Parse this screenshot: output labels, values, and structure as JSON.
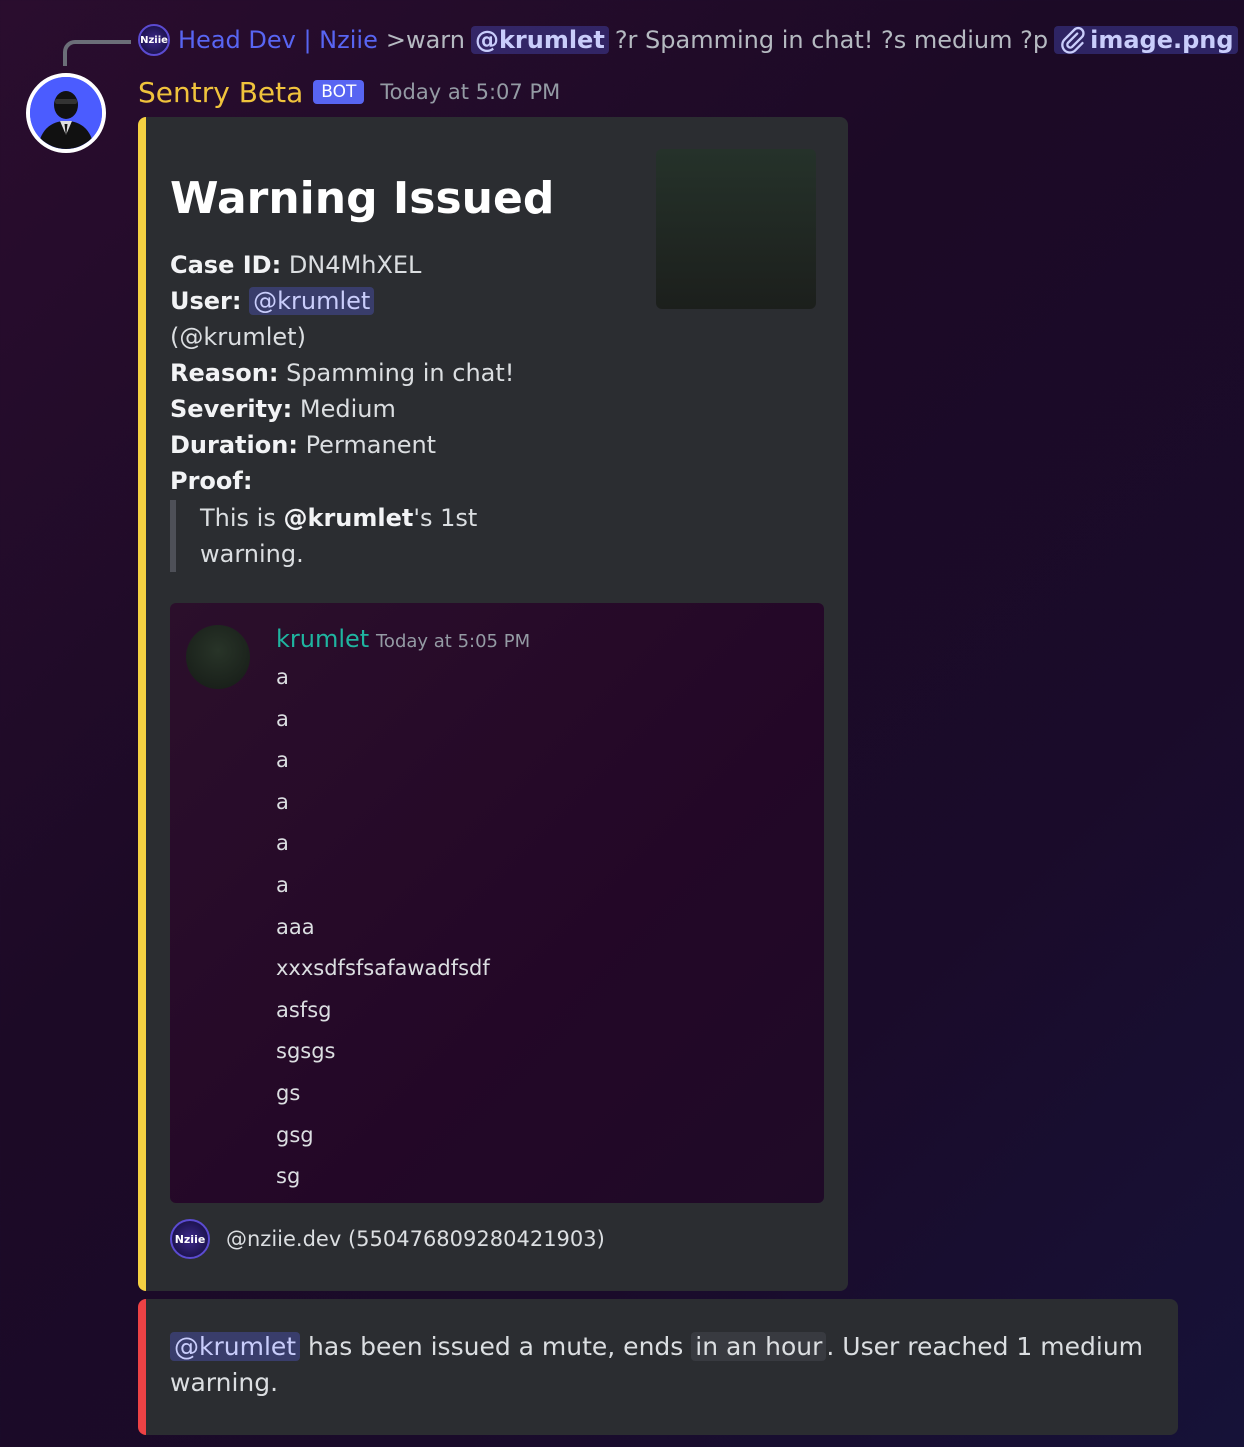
{
  "reply": {
    "avatar_text": "Nziie",
    "author": "Head Dev | Nziie",
    "command_prefix": ">warn",
    "mention": "@krumlet",
    "command_rest": "?r Spamming in chat! ?s medium ?p",
    "attachment": "image.png"
  },
  "message": {
    "bot_name": "Sentry Beta",
    "bot_tag": "BOT",
    "timestamp": "Today at 5:07 PM"
  },
  "embed": {
    "accent_color": "#f5d142",
    "title": "Warning Issued",
    "fields": {
      "case_label": "Case ID:",
      "case_value": "DN4MhXEL",
      "user_label": "User:",
      "user_mention": "@krumlet",
      "user_handle": "(@krumlet)",
      "reason_label": "Reason:",
      "reason_value": "Spamming in chat!",
      "severity_label": "Severity:",
      "severity_value": "Medium",
      "duration_label": "Duration:",
      "duration_value": "Permanent",
      "proof_label": "Proof:"
    },
    "quote": {
      "prefix": "This is",
      "mention": "@krumlet",
      "suffix": "'s 1st warning."
    },
    "proof_message": {
      "author": "krumlet",
      "timestamp": "Today at 5:05 PM",
      "lines": [
        "a",
        "a",
        "a",
        "a",
        "a",
        "a",
        "aaa",
        "xxxsdfsfsafawadfsdf",
        "asfsg",
        "sgsgs",
        "gs",
        "gsg",
        "sg"
      ]
    },
    "footer": {
      "icon_text": "Nziie",
      "text": "@nziie.dev (550476809280421903)"
    }
  },
  "mute_embed": {
    "accent_color": "#ed4245",
    "mention": "@krumlet",
    "text_1": "has been issued a mute, ends",
    "time_badge": "in an hour",
    "text_2": ". User reached 1 medium warning."
  }
}
